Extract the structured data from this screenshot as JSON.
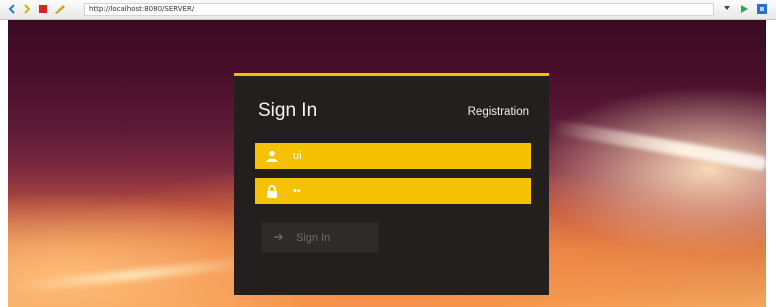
{
  "browser": {
    "url": "http://localhost:8080/SERVER/"
  },
  "login": {
    "title": "Sign In",
    "registration_link": "Registration",
    "username": {
      "value": "ui"
    },
    "password": {
      "value": "••"
    },
    "submit_label": "Sign In"
  },
  "colors": {
    "accent": "#f6c200",
    "panel": "#231f1e",
    "button": "#2e2b2a"
  }
}
